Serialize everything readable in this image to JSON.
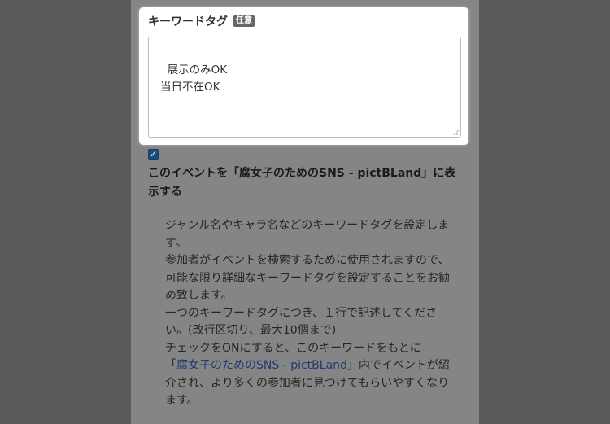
{
  "keyword_field": {
    "label": "キーワードタグ",
    "badge": "任意",
    "value": "展示のみOK\n当日不在OK"
  },
  "sns_checkbox": {
    "checked": true,
    "label": "このイベントを「腐女子のためのSNS - pictBLand」に表示する"
  },
  "help": {
    "line1": "ジャンル名やキャラ名などのキーワードタグを設定します。",
    "line2": "参加者がイベントを検索するために使用されますので、可能な限り詳細なキーワードタグを設定することをお勧め致します。",
    "line3": "一つのキーワードタグにつき、１行で記述してください。(改行区切り、最大10個まで)",
    "line4": "チェックをONにすると、このキーワードをもとに",
    "line5_open": "「",
    "link_text": "腐女子のためのSNS - pictBLand",
    "line5_rest": "」内でイベントが紹介され、より多くの参加者に見つけてもらいやすくなります。"
  }
}
